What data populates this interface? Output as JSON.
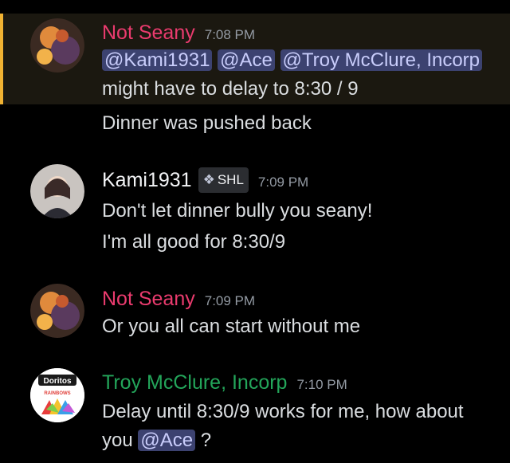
{
  "colors": {
    "not_seany": "#ea3b6e",
    "kami": "#f2f3f5",
    "troy": "#23a55a",
    "highlight_bar": "#f0b232",
    "mention_bg": "#3c4270"
  },
  "messages": [
    {
      "author": "Not Seany",
      "time": "7:08 PM",
      "mentions": [
        "@Kami1931",
        "@Ace",
        "@Troy McClure, Incorp"
      ],
      "lines": [
        "might have to delay to 8:30 / 9",
        "Dinner was pushed back"
      ]
    },
    {
      "author": "Kami1931",
      "badge_icon": "diamond-badge-icon",
      "badge": "SHL",
      "time": "7:09 PM",
      "lines": [
        "Don't let dinner bully you seany!",
        "I'm all good for 8:30/9"
      ]
    },
    {
      "author": "Not Seany",
      "time": "7:09 PM",
      "lines": [
        "Or you all can start without me"
      ]
    },
    {
      "author": "Troy McClure, Incorp",
      "avatar_text": "Doritos",
      "avatar_subtext": "RAINBOWS",
      "time": "7:10 PM",
      "lines": [
        "Delay until 8:30/9 works for me, how about",
        "you"
      ],
      "trailing_mention": "@Ace",
      "trailing_text": "?"
    }
  ]
}
